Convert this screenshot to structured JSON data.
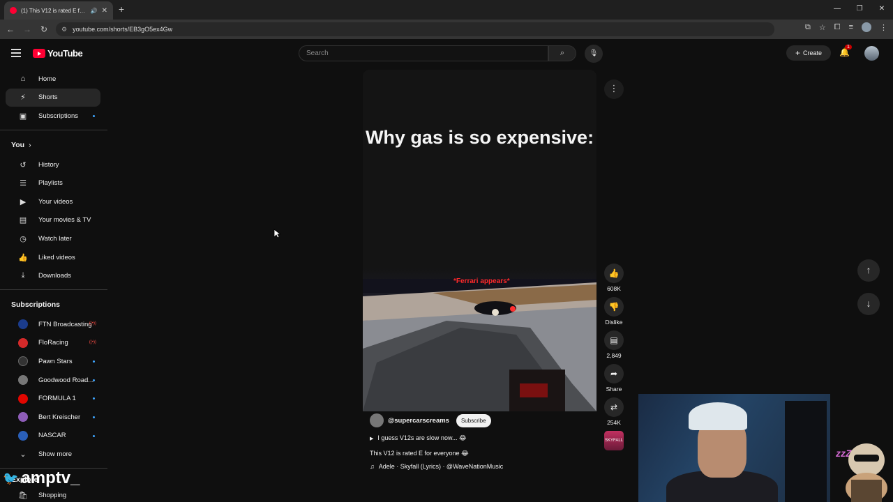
{
  "browser": {
    "tab_title": "(1) This V12 is rated E for e...",
    "url": "youtube.com/shorts/EB3gO5ex4Gw",
    "new_tab": "+",
    "min": "—",
    "max": "❐",
    "close": "✕"
  },
  "header": {
    "logo_text": "YouTube",
    "search_placeholder": "Search",
    "create_label": "Create",
    "notif_count": "1"
  },
  "sidebar": {
    "main": [
      {
        "label": "Home",
        "icon": "⌂"
      },
      {
        "label": "Shorts",
        "icon": "⚡"
      },
      {
        "label": "Subscriptions",
        "icon": "▣"
      }
    ],
    "you_label": "You",
    "you_items": [
      {
        "label": "History",
        "icon": "↺"
      },
      {
        "label": "Playlists",
        "icon": "☰"
      },
      {
        "label": "Your videos",
        "icon": "▶"
      },
      {
        "label": "Your movies & TV",
        "icon": "🎬"
      },
      {
        "label": "Watch later",
        "icon": "◷"
      },
      {
        "label": "Liked videos",
        "icon": "👍"
      },
      {
        "label": "Downloads",
        "icon": "⤓"
      }
    ],
    "subs_label": "Subscriptions",
    "subs": [
      {
        "label": "FTN Broadcasting",
        "color": "#1b3c8c"
      },
      {
        "label": "FloRacing",
        "color": "#d42a2a"
      },
      {
        "label": "Pawn Stars",
        "color": "#222222"
      },
      {
        "label": "Goodwood Road...",
        "color": "#777777"
      },
      {
        "label": "FORMULA 1",
        "color": "#e10600"
      },
      {
        "label": "Bert Kreischer",
        "color": "#8e5db8"
      },
      {
        "label": "NASCAR",
        "color": "#2a5fb8"
      }
    ],
    "show_more": "Show more",
    "explore_label": "Explore",
    "shopping": "Shopping"
  },
  "short": {
    "title": "Why gas is so expensive:",
    "caption": "*Ferrari appears*",
    "channel": "@supercarscreams",
    "subscribe": "Subscribe",
    "desc_line": "I guess V12s are slow now... 😂",
    "desc": "This V12 is rated E for everyone 😂",
    "music": "Adele · Skyfall (Lyrics) · @WaveNationMusic"
  },
  "actions": {
    "likes": "608K",
    "dislike": "Dislike",
    "comments": "2,849",
    "share": "Share",
    "remix": "254K",
    "remix_thumb": "SKYFALL"
  },
  "overlay": {
    "watermark": "amptv_",
    "zzz": "zzZ"
  }
}
